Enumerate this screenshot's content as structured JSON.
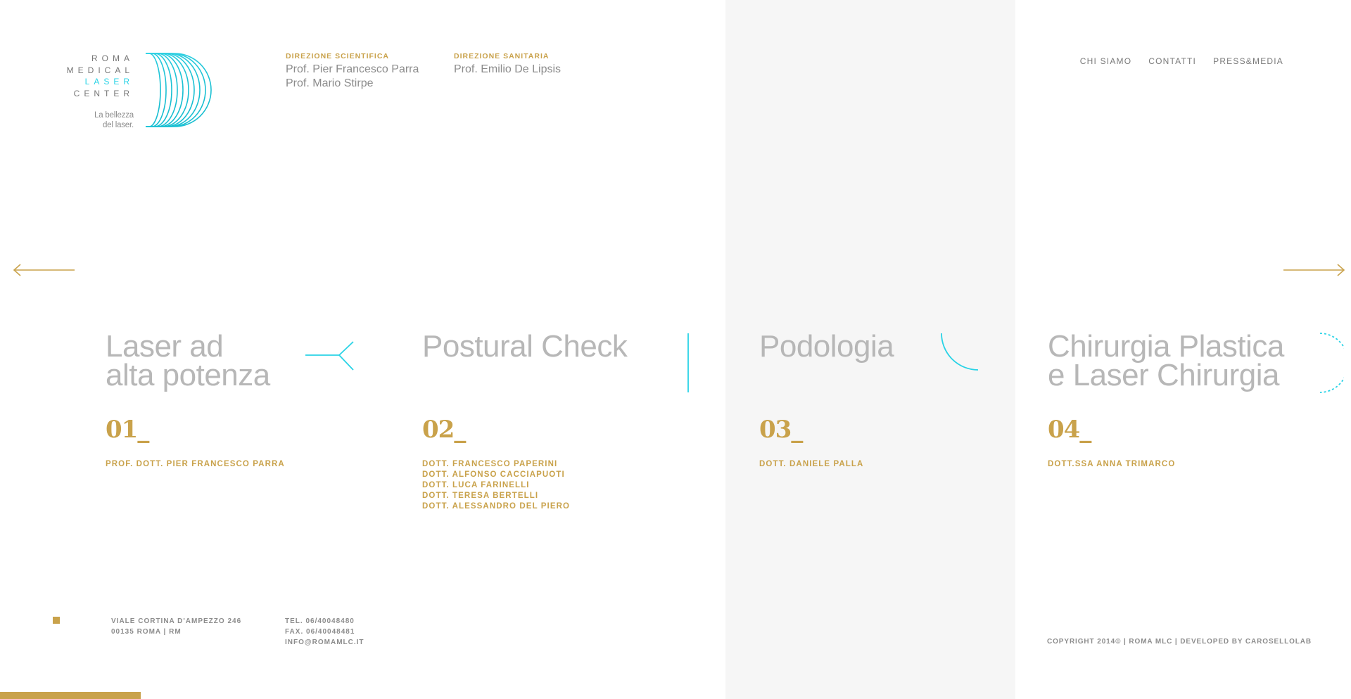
{
  "logo": {
    "words": [
      "ROMA",
      "MEDICAL",
      "LASER",
      "CENTER"
    ],
    "tagline_1": "La bellezza",
    "tagline_2": "del laser."
  },
  "staff": [
    {
      "label": "DIREZIONE SCIENTIFICA",
      "names": [
        "Prof. Pier Francesco Parra",
        "Prof. Mario Stirpe"
      ]
    },
    {
      "label": "DIREZIONE SANITARIA",
      "names": [
        "Prof. Emilio De Lipsis"
      ]
    }
  ],
  "nav": [
    "CHI SIAMO",
    "CONTATTI",
    "PRESS&MEDIA"
  ],
  "slides": [
    {
      "title_1": "Laser ad",
      "title_2": "alta potenza",
      "number": "01_",
      "doctors": [
        "PROF. DOTT. PIER FRANCESCO PARRA"
      ]
    },
    {
      "title_1": "Postural Check",
      "title_2": "",
      "number": "02_",
      "doctors": [
        "DOTT. FRANCESCO PAPERINI",
        "DOTT. ALFONSO CACCIAPUOTI",
        "DOTT. LUCA FARINELLI",
        "DOTT. TERESA BERTELLI",
        "DOTT. ALESSANDRO DEL PIERO"
      ]
    },
    {
      "title_1": "Podologia",
      "title_2": "",
      "number": "03_",
      "doctors": [
        "DOTT. DANIELE PALLA"
      ]
    },
    {
      "title_1": "Chirurgia Plastica",
      "title_2": "e Laser Chirurgia",
      "number": "04_",
      "doctors": [
        "DOTT.SSA ANNA TRIMARCO"
      ]
    }
  ],
  "footer": {
    "address_1": "VIALE CORTINA D'AMPEZZO 246",
    "address_2": "00135 ROMA | RM",
    "tel": "TEL. 06/40048480",
    "fax": "FAX. 06/40048481",
    "email": "INFO@ROMAMLC.IT",
    "copyright": "COPYRIGHT 2014© | ROMA MLC | DEVELOPED BY CAROSELLOLAB"
  },
  "colors": {
    "gold": "#c9a24b",
    "cyan": "#29d3e6",
    "grey_panel": "#f6f6f6"
  },
  "icons": [
    "prev-arrow-icon",
    "next-arrow-icon",
    "logo-d-mark-icon"
  ]
}
